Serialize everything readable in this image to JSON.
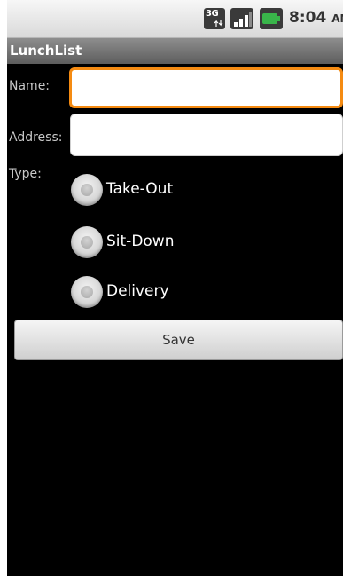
{
  "status_bar": {
    "network_icon": "3g-data-icon",
    "network_label": "3G",
    "signal_icon": "signal-strength-icon",
    "battery_icon": "battery-charging-icon",
    "time": "8:04",
    "ampm": "AM"
  },
  "app": {
    "title": "LunchList"
  },
  "form": {
    "name_label": "Name:",
    "name_value": "",
    "address_label": "Address:",
    "address_value": "",
    "type_label": "Type:",
    "type_options": [
      "Take-Out",
      "Sit-Down",
      "Delivery"
    ],
    "save_label": "Save"
  },
  "colors": {
    "focus_accent": "#f58b12",
    "background": "#000000",
    "battery": "#39b54a"
  }
}
